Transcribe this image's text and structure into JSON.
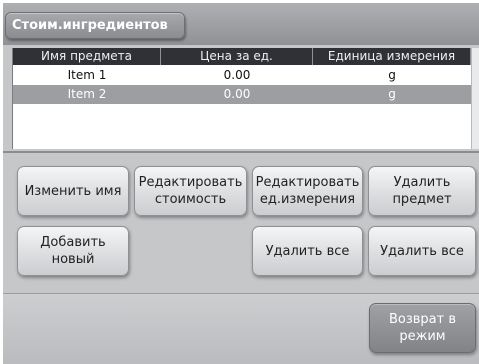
{
  "header": {
    "title": "Стоим.ингредиентов"
  },
  "table": {
    "columns": [
      "Имя предмета",
      "Цена за ед.",
      "Единица измерения"
    ],
    "rows": [
      {
        "name": "Item 1",
        "price": "0.00",
        "unit": "g",
        "selected": false
      },
      {
        "name": "Item 2",
        "price": "0.00",
        "unit": "g",
        "selected": true
      }
    ]
  },
  "buttons": {
    "rename": "Изменить имя",
    "edit_cost": "Редактировать\nстоимость",
    "edit_unit": "Редактировать\nед.измерения",
    "delete_item": "Удалить\nпредмет",
    "add_new": "Добавить новый",
    "delete_all_1": "Удалить все",
    "delete_all_2": "Удалить все",
    "return": "Возврат в\nрежим"
  },
  "colors": {
    "header_bar": "#9a9ca0",
    "table_header": "#2f3136",
    "selected_row": "#9c9ea2",
    "screen_bg": "#c6c7c9"
  }
}
